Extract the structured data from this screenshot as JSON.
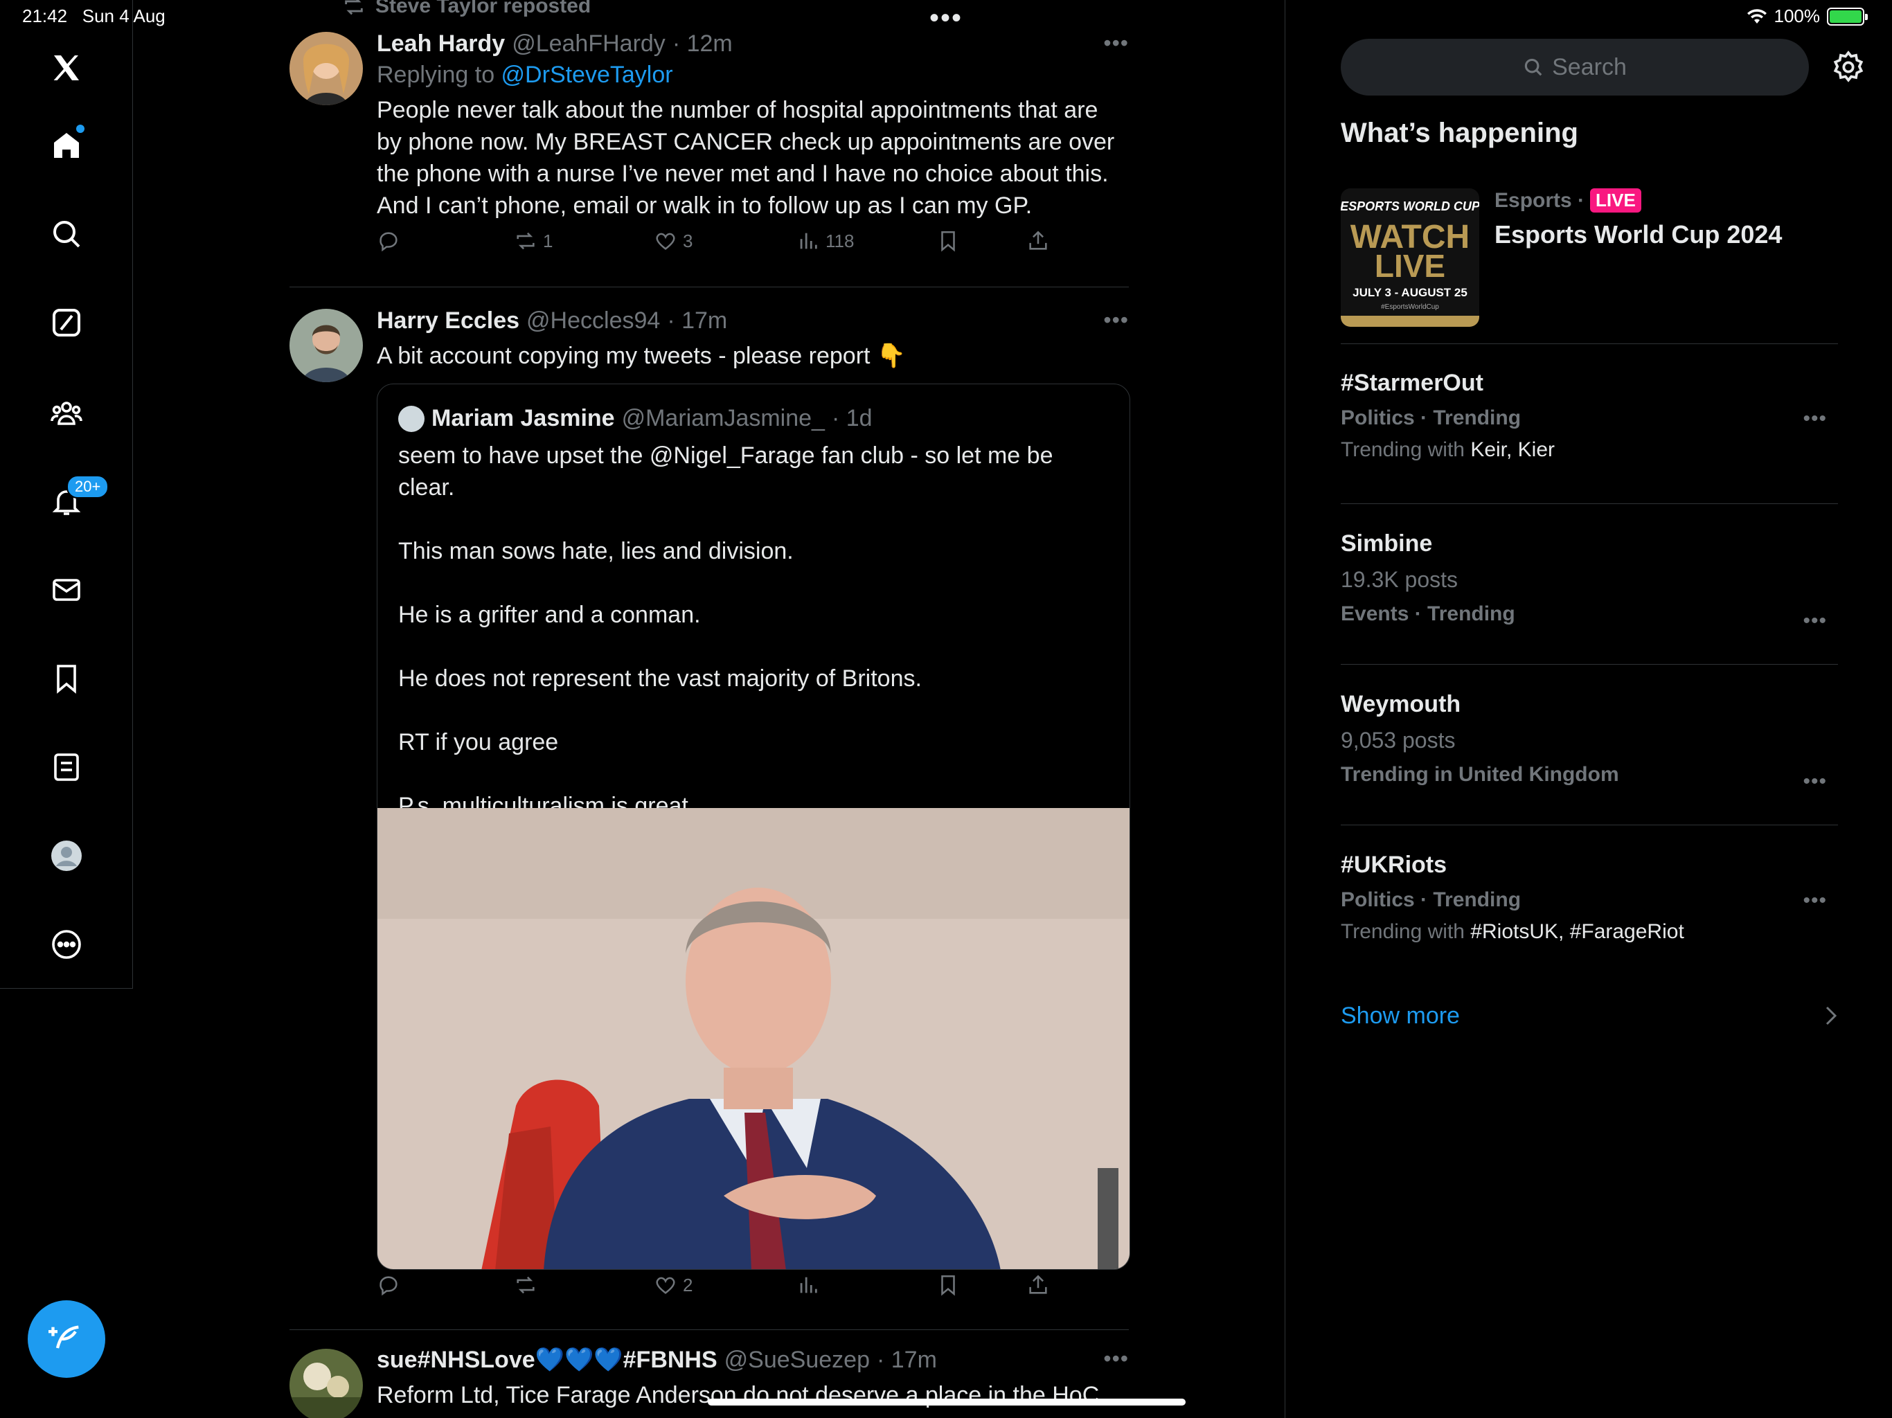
{
  "status": {
    "time": "21:42",
    "date": "Sun 4 Aug",
    "battery": "100%"
  },
  "nav": {
    "notifications_badge": "20+"
  },
  "feed": {
    "repost_label": "Steve Taylor reposted",
    "tweets": [
      {
        "name": "Leah Hardy",
        "handle": "@LeahFHardy",
        "time": "· 12m",
        "reply_prefix": "Replying to ",
        "reply_to": "@DrSteveTaylor",
        "lines": [
          "People never talk about the number of hospital appointments that are",
          "by phone now. My BREAST CANCER check up appointments are over",
          "the phone with a nurse I’ve never met and I have no choice about this.",
          "And I can’t phone, email or walk in to follow up as I can my GP."
        ],
        "retweets": "1",
        "likes": "3",
        "views": "118"
      },
      {
        "name": "Harry Eccles",
        "handle": "@Heccles94",
        "time": "· 17m",
        "text": "A bit account copying my tweets - please report 👇",
        "likes": "2",
        "quote": {
          "name": "Mariam Jasmine",
          "handle": "@MariamJasmine_",
          "time": "· 1d",
          "paragraphs": [
            "seem to have upset the @Nigel_Farage fan club - so let me be clear.",
            "This man sows hate, lies and division.",
            "He is a grifter and a conman.",
            "He does not represent the vast majority of Britons.",
            "RT if you agree",
            "P.s. multiculturalism is great."
          ]
        }
      },
      {
        "name": "sue#NHSLove💙💙💙#FBNHS",
        "handle": "@SueSuezep",
        "time": "· 17m",
        "text": "Reform Ltd, Tice Farage Anderson do not deserve a place in the HoC"
      }
    ]
  },
  "sidebar": {
    "search_placeholder": "Search",
    "section_title": "What’s happening",
    "promo": {
      "category": "Esports ·",
      "live": "LIVE",
      "title": "Esports World Cup 2024",
      "image_text_top": "ESPORTS WORLD CUP",
      "image_text_main1": "WATCH",
      "image_text_main2": "LIVE",
      "image_text_dates": "JULY 3 - AUGUST 25",
      "image_text_tag": "#EsportsWorldCup"
    },
    "trends": [
      {
        "name": "#StarmerOut",
        "meta": "Politics · Trending",
        "sub_prefix": "Trending with ",
        "sub_values": "Keir, Kier"
      },
      {
        "name": "Simbine",
        "posts": "19.3K posts",
        "meta": "Events · Trending"
      },
      {
        "name": "Weymouth",
        "posts": "9,053 posts",
        "meta": "Trending in United Kingdom"
      },
      {
        "name": "#UKRiots",
        "meta": "Politics · Trending",
        "sub_prefix": "Trending with ",
        "sub_values": "#RiotsUK, #FarageRiot"
      }
    ],
    "show_more": "Show more"
  },
  "colors": {
    "accent": "#1d9bf0",
    "live": "#f91880",
    "muted": "#71767b",
    "border": "#2f3336"
  }
}
